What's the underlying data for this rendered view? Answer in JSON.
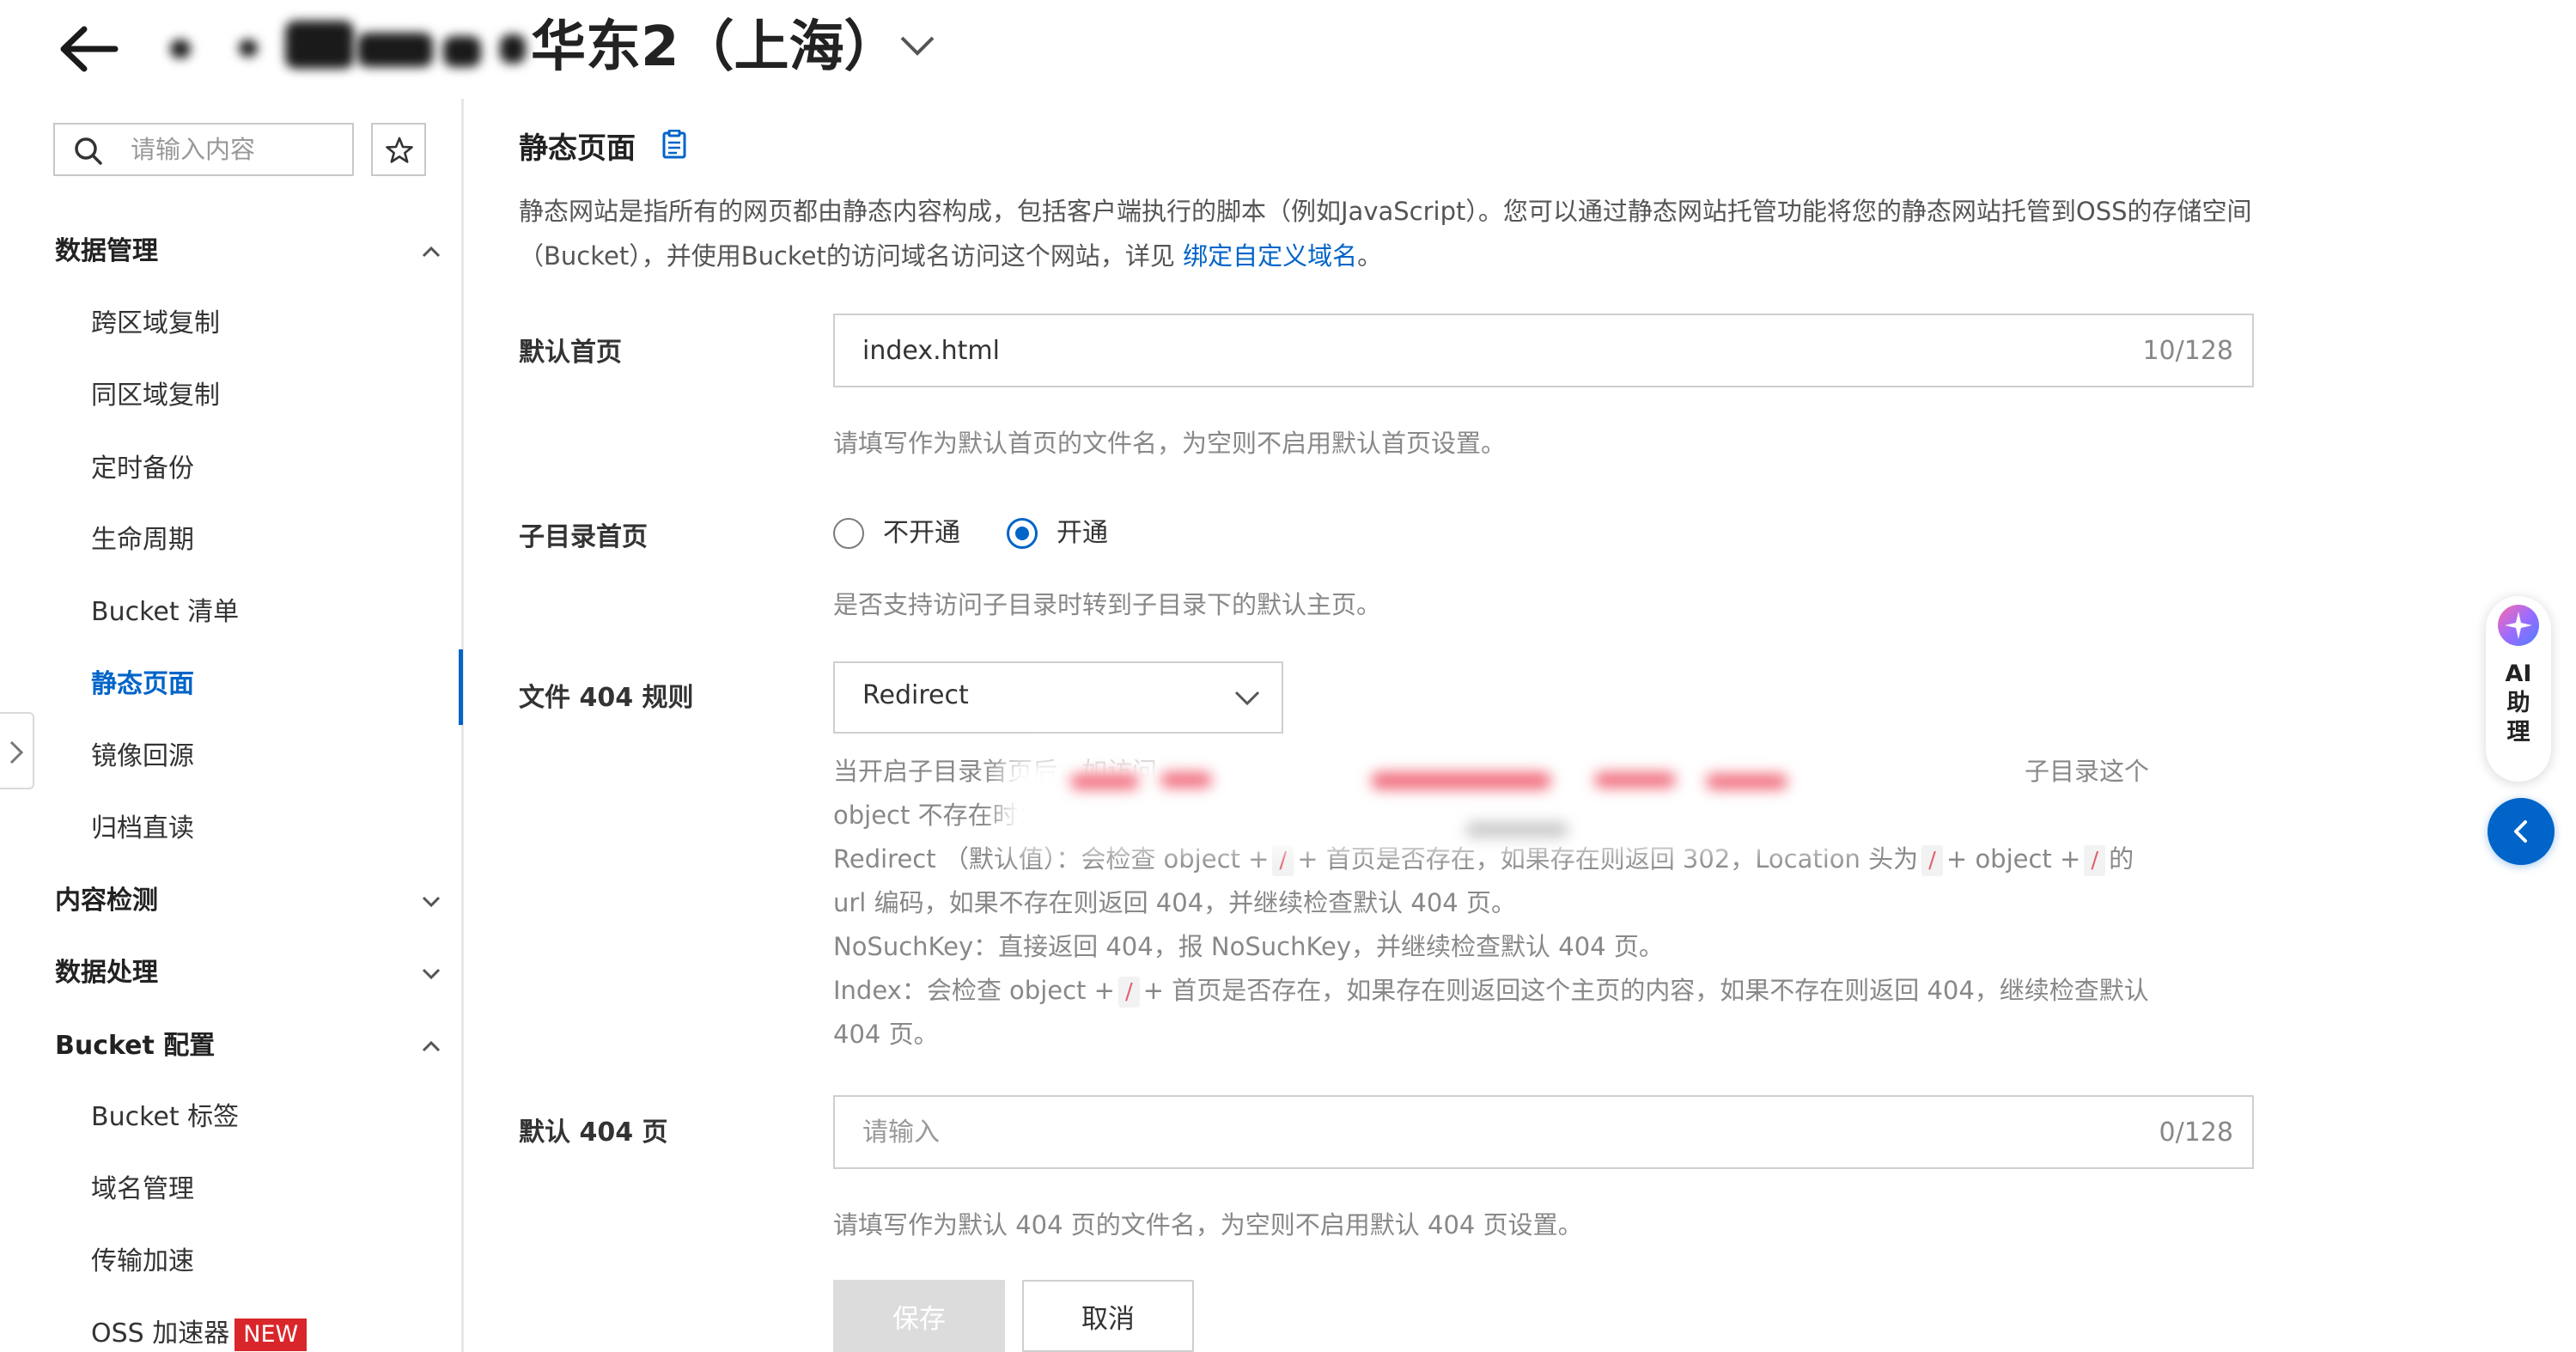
{
  "header": {
    "region_title": "华东2（上海）"
  },
  "sidebar": {
    "search_placeholder": "请输入内容",
    "groups": [
      {
        "label": "数据管理",
        "expanded": true,
        "items": [
          "跨区域复制",
          "同区域复制",
          "定时备份",
          "生命周期",
          "Bucket 清单",
          "静态页面",
          "镜像回源",
          "归档直读"
        ]
      },
      {
        "label": "内容检测",
        "expanded": false
      },
      {
        "label": "数据处理",
        "expanded": false
      },
      {
        "label": "Bucket 配置",
        "expanded": true,
        "items": [
          "Bucket 标签",
          "域名管理",
          "传输加速",
          "OSS 加速器"
        ]
      }
    ],
    "active_item": "静态页面",
    "new_badge": "NEW"
  },
  "main": {
    "section_title": "静态页面",
    "description_line1": "静态网站是指所有的网页都由静态内容构成，包括客户端执行的脚本（例如JavaScript）。您可以通过静态网站托管功能将您的静态网站托管到OSS的存储空间",
    "description_line2": "（Bucket），并使用Bucket的访问域名访问这个网站，详见 ",
    "description_link": "绑定自定义域名",
    "description_end": "。",
    "default_index": {
      "label": "默认首页",
      "value": "index.html",
      "counter": "10/128",
      "help": "请填写作为默认首页的文件名，为空则不启用默认首页设置。"
    },
    "subdir_index": {
      "label": "子目录首页",
      "options": [
        "不开通",
        "开通"
      ],
      "selected": "开通",
      "help": "是否支持访问子目录时转到子目录下的默认主页。"
    },
    "rule_404": {
      "label": "文件 404 规则",
      "selected": "Redirect",
      "desc_line1_start": "当开启子目录首页后，如访问",
      "desc_line1_end": "子目录这个",
      "desc_line2": "object 不存在时：",
      "redirect_text_a": "Redirect （默认值）：会检查 object +",
      "redirect_text_b": "+ 首页是否存在，如果存在则返回 302，Location 头为",
      "redirect_text_c": "+ object +",
      "redirect_text_d": "的",
      "desc_line4": "url 编码，如果不存在则返回 404，并继续检查默认 404 页。",
      "desc_line5": "NoSuchKey：直接返回 404，报 NoSuchKey，并继续检查默认 404 页。",
      "index_text_a": "Index：会检查 object +",
      "index_text_b": "+ 首页是否存在，如果存在则返回这个主页的内容，如果不存在则返回 404，继续检查默认",
      "desc_line7": "404 页。",
      "slash": "/"
    },
    "default_404": {
      "label": "默认 404 页",
      "placeholder": "请输入",
      "counter": "0/128",
      "help": "请填写作为默认 404 页的文件名，为空则不启用默认 404 页设置。"
    },
    "buttons": {
      "save": "保存",
      "cancel": "取消"
    }
  },
  "assistant": {
    "label": "AI\n助\n理"
  },
  "colors": {
    "accent": "#0064c8",
    "badge": "#d9262a",
    "code": "#e0606c"
  }
}
